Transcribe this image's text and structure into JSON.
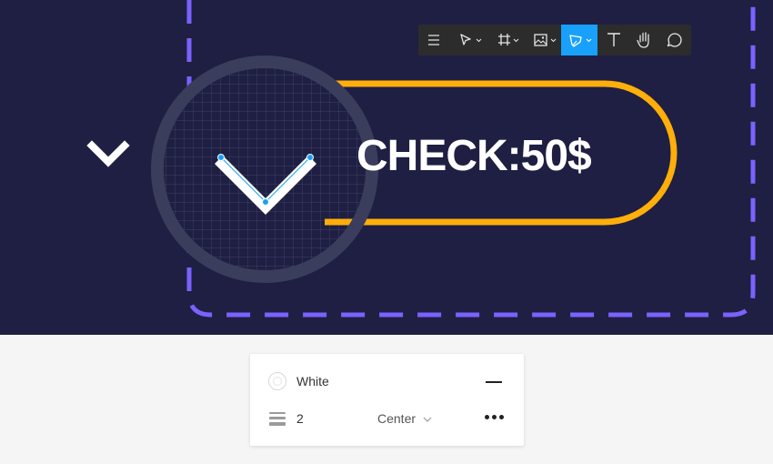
{
  "canvas": {
    "background": "#1e1f42",
    "button_label": "CHECK:50$",
    "pill_stroke_color": "#ffae0a",
    "frame_dash_color": "#7b61ff",
    "chevron_color": "#ffffff",
    "anchor_point_color": "#18a0fb"
  },
  "toolbar": {
    "tools": [
      {
        "icon": "menu-icon",
        "active": false
      },
      {
        "icon": "move-tool-icon",
        "has_dropdown": true,
        "active": false
      },
      {
        "icon": "frame-tool-icon",
        "has_dropdown": true,
        "active": false
      },
      {
        "icon": "image-tool-icon",
        "has_dropdown": true,
        "active": false
      },
      {
        "icon": "pen-tool-icon",
        "has_dropdown": true,
        "active": true
      },
      {
        "icon": "text-tool-icon",
        "active": false
      },
      {
        "icon": "hand-tool-icon",
        "active": false
      },
      {
        "icon": "comment-tool-icon",
        "active": false
      }
    ],
    "active_color": "#18a0fb"
  },
  "stroke_panel": {
    "fill_name": "White",
    "weight": "2",
    "align": "Center"
  }
}
